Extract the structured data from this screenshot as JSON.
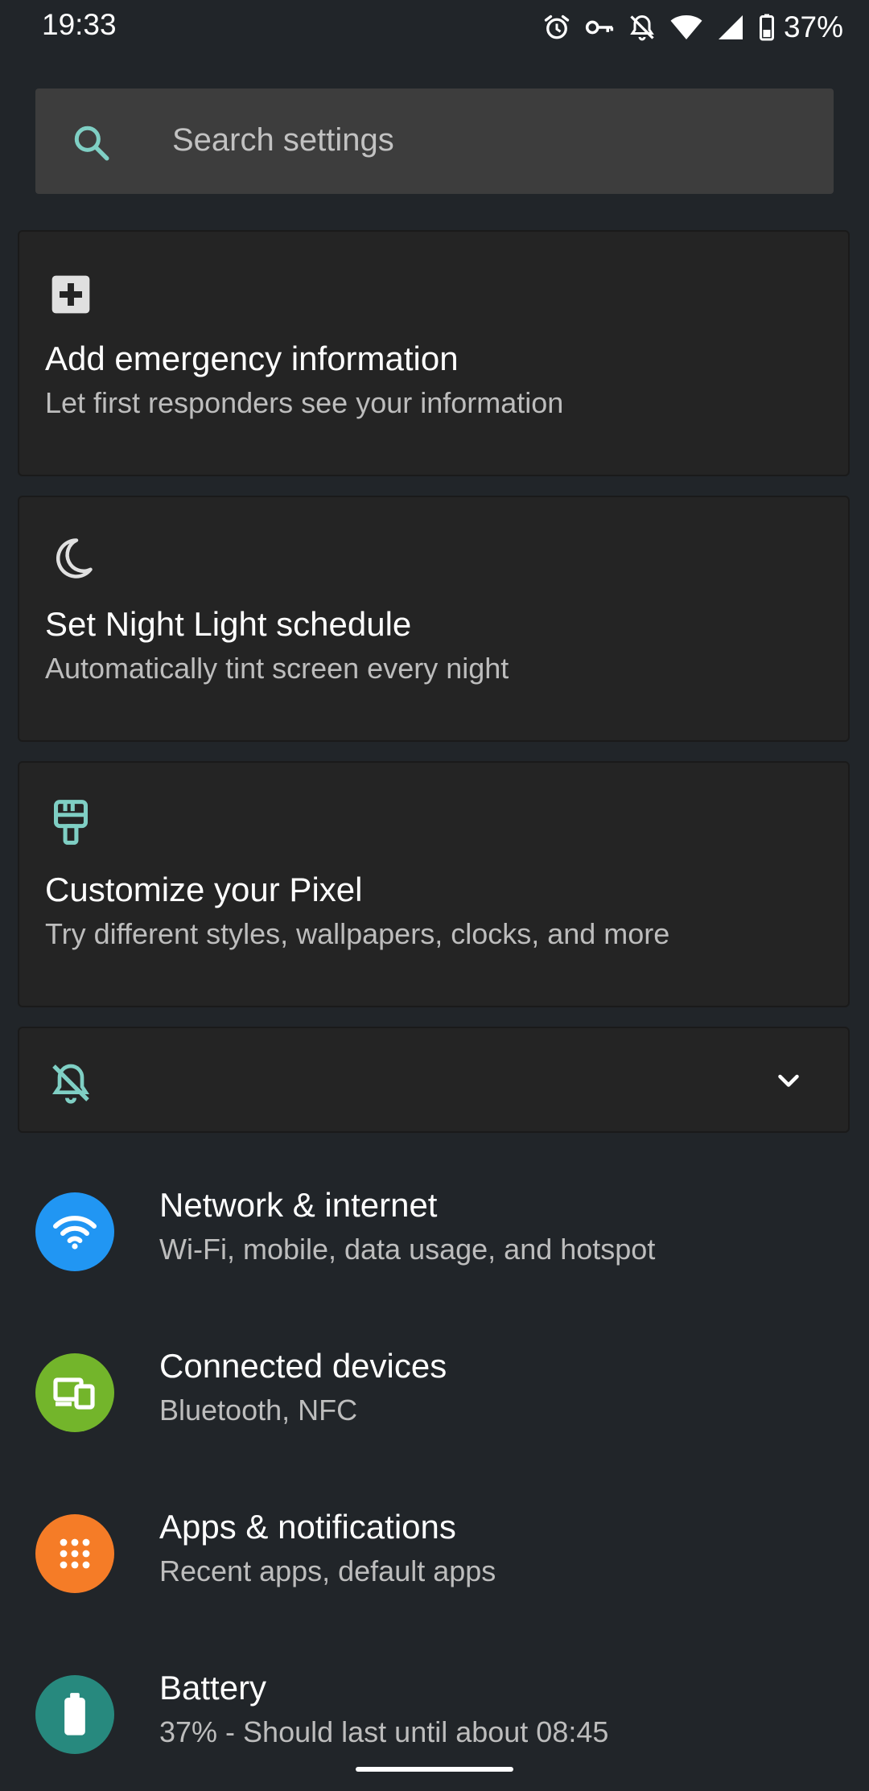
{
  "status_bar": {
    "time": "19:33",
    "battery_percent": "37%",
    "icons": [
      "alarm-icon",
      "vpn-key-icon",
      "notifications-off-icon",
      "wifi-icon",
      "cell-signal-icon",
      "battery-icon"
    ]
  },
  "search": {
    "placeholder": "Search settings"
  },
  "suggestions": [
    {
      "icon": "medical-plus-icon",
      "title": "Add emergency information",
      "subtitle": "Let first responders see your information"
    },
    {
      "icon": "moon-icon",
      "title": "Set Night Light schedule",
      "subtitle": "Automatically tint screen every night"
    },
    {
      "icon": "paint-brush-icon",
      "title": "Customize your Pixel",
      "subtitle": "Try different styles, wallpapers, clocks, and more"
    }
  ],
  "dnd_condition": {
    "icon": "notifications-off-icon",
    "expand_icon": "chevron-down-icon"
  },
  "settings": [
    {
      "icon": "wifi-icon",
      "color": "#2196f3",
      "title": "Network & internet",
      "subtitle": "Wi-Fi, mobile, data usage, and hotspot"
    },
    {
      "icon": "devices-icon",
      "color": "#73b52b",
      "title": "Connected devices",
      "subtitle": "Bluetooth, NFC"
    },
    {
      "icon": "apps-grid-icon",
      "color": "#f57c27",
      "title": "Apps & notifications",
      "subtitle": "Recent apps, default apps"
    },
    {
      "icon": "battery-icon",
      "color": "#27897e",
      "title": "Battery",
      "subtitle": "37% - Should last until about 08:45"
    }
  ],
  "colors": {
    "background": "#212529",
    "card": "#242424",
    "search_field": "#3d3d3d",
    "accent_teal": "#7fcfc4"
  }
}
